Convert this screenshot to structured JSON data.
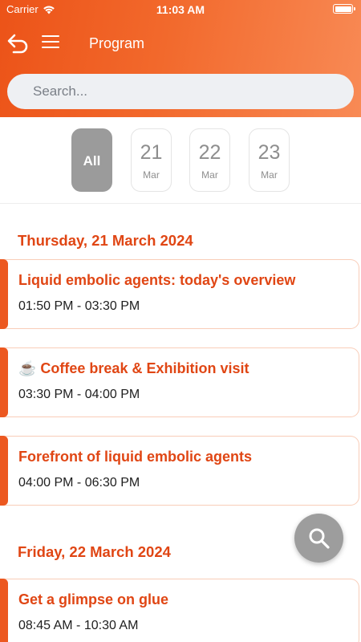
{
  "status_bar": {
    "carrier": "Carrier",
    "time": "11:03 AM"
  },
  "nav": {
    "title": "Program"
  },
  "search": {
    "placeholder": "Search..."
  },
  "date_filter": {
    "all_label": "All",
    "dates": [
      {
        "day": "21",
        "month": "Mar"
      },
      {
        "day": "22",
        "month": "Mar"
      },
      {
        "day": "23",
        "month": "Mar"
      }
    ],
    "selected": "All"
  },
  "days": [
    {
      "heading": "Thursday, 21 March 2024",
      "sessions": [
        {
          "title": "Liquid embolic agents: today's overview",
          "time": "01:50 PM - 03:30 PM"
        },
        {
          "title": "☕ Coffee break & Exhibition visit",
          "time": "03:30 PM - 04:00 PM"
        },
        {
          "title": "Forefront of liquid embolic agents",
          "time": "04:00 PM - 06:30 PM"
        }
      ]
    },
    {
      "heading": "Friday, 22 March 2024",
      "sessions": [
        {
          "title": "Get a glimpse on glue",
          "time": "08:45 AM - 10:30 AM"
        }
      ]
    }
  ],
  "colors": {
    "accent": "#ec5820",
    "heading": "#e04614",
    "chip_active": "#9b9b9b",
    "fab": "#9d9d9d"
  },
  "icons": [
    "back-icon",
    "menu-icon",
    "wifi-icon",
    "battery-icon",
    "search-icon"
  ]
}
